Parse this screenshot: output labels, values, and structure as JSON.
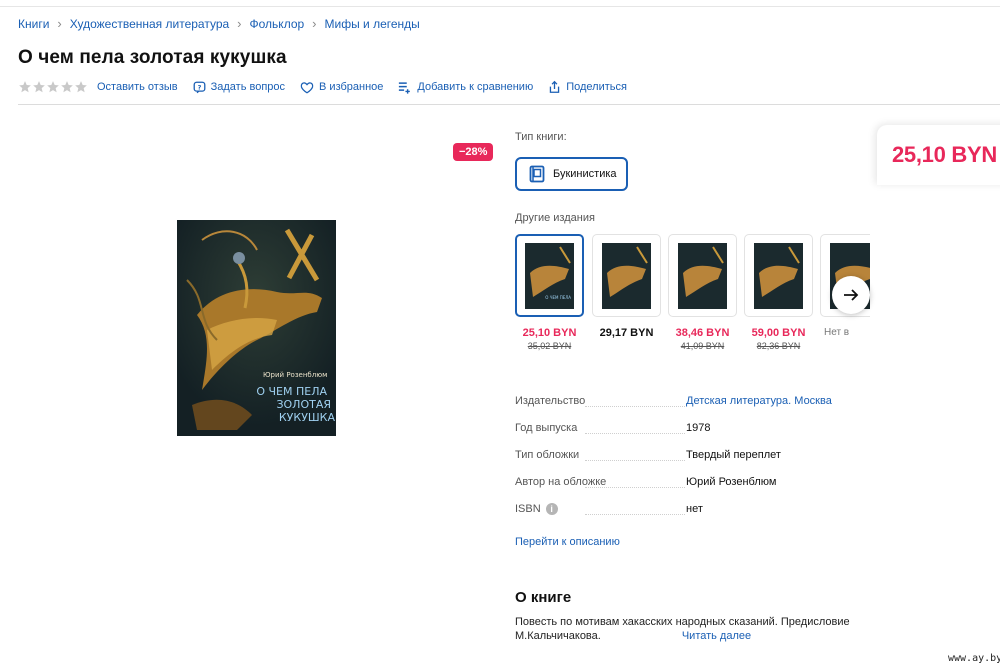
{
  "breadcrumb": [
    "Книги",
    "Художественная литература",
    "Фольклор",
    "Мифы и легенды"
  ],
  "title": "О чем пела золотая кукушка",
  "rating": {
    "stars_filled": 0,
    "stars_total": 5
  },
  "actions": {
    "review": "Оставить отзыв",
    "question": "Задать вопрос",
    "favorite": "В избранное",
    "compare": "Добавить к сравнению",
    "share": "Поделиться"
  },
  "discount_badge": "−28%",
  "cover": {
    "author": "Юрий Розенблюм",
    "title_lines": [
      "О ЧЕМ ПЕЛА",
      "ЗОЛОТАЯ",
      "КУКУШКА"
    ]
  },
  "book_type": {
    "label": "Тип книги:",
    "selected": "Букинистика"
  },
  "editions": {
    "label": "Другие издания",
    "items": [
      {
        "price": "25,10 BYN",
        "old_price": "35,02 BYN",
        "sale": true
      },
      {
        "price": "29,17 BYN",
        "old_price": "",
        "sale": false
      },
      {
        "price": "38,46 BYN",
        "old_price": "41,09 BYN",
        "sale": true
      },
      {
        "price": "59,00 BYN",
        "old_price": "82,36 BYN",
        "sale": true
      },
      {
        "price": "Нет в",
        "old_price": "",
        "sale": false
      }
    ]
  },
  "specs": [
    {
      "key": "Издательство",
      "value": "Детская литература. Москва",
      "link": true
    },
    {
      "key": "Год выпуска",
      "value": "1978",
      "link": false
    },
    {
      "key": "Тип обложки",
      "value": "Твердый переплет",
      "link": false
    },
    {
      "key": "Автор на обложке",
      "value": "Юрий Розенблюм",
      "link": false
    },
    {
      "key": "ISBN",
      "value": "нет",
      "link": false
    }
  ],
  "goto_description": "Перейти к описанию",
  "about": {
    "title": "О книге",
    "text_line1": "Повесть по мотивам хакасских народных сказаний. Предисловие",
    "text_line2": "М.Кальчичакова.",
    "read_more": "Читать далее"
  },
  "price": "25,10 BYN",
  "watermark": "www.ay.by",
  "colors": {
    "accent": "#1a5fb4",
    "sale": "#e8285a"
  }
}
